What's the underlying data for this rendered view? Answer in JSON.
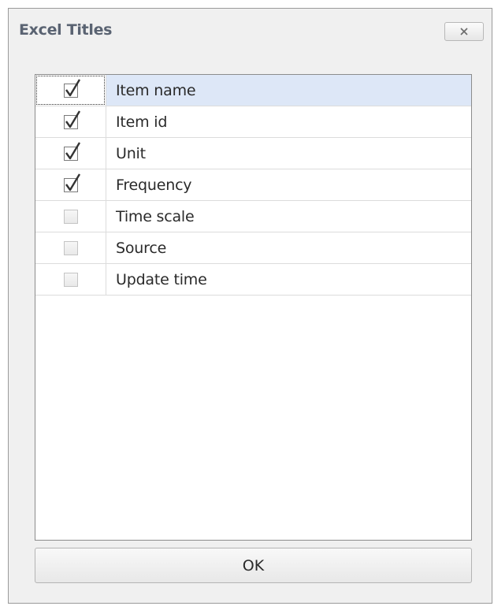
{
  "window": {
    "title": "Excel Titles",
    "close_icon": "close-icon"
  },
  "list": {
    "items": [
      {
        "label": "Item name",
        "checked": true,
        "selected": true
      },
      {
        "label": "Item id",
        "checked": true,
        "selected": false
      },
      {
        "label": "Unit",
        "checked": true,
        "selected": false
      },
      {
        "label": "Frequency",
        "checked": true,
        "selected": false
      },
      {
        "label": "Time scale",
        "checked": false,
        "selected": false
      },
      {
        "label": "Source",
        "checked": false,
        "selected": false
      },
      {
        "label": "Update time",
        "checked": false,
        "selected": false
      }
    ]
  },
  "footer": {
    "ok_label": "OK"
  },
  "colors": {
    "selection": "#dde7f7",
    "title_text": "#5a6372",
    "border": "#8c8c8c"
  }
}
